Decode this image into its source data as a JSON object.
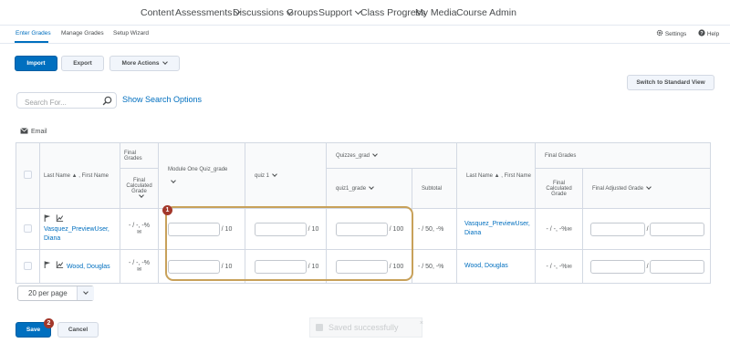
{
  "nav": {
    "items": [
      "Content",
      "Assessments",
      "Discussions",
      "Groups",
      "Support",
      "Class Progress",
      "My Media",
      "Course Admin"
    ]
  },
  "subnav": {
    "tabs": [
      "Enter Grades",
      "Manage Grades",
      "Setup Wizard"
    ],
    "settings": "Settings",
    "help": "Help"
  },
  "toolbar": {
    "import": "Import",
    "export": "Export",
    "more_actions": "More Actions",
    "switch_view": "Switch to Standard View"
  },
  "search": {
    "placeholder": "Search For...",
    "show_options": "Show Search Options"
  },
  "email": "Email",
  "table": {
    "header": {
      "name": "Last Name ▲ , First Name",
      "final_grades_top": "Final Grades",
      "final_calculated": "Final Calculated Grade",
      "module_one": "Module One Quiz_grade",
      "quiz1": "quiz 1",
      "quizzes_grad": "Quizzes_grad",
      "quiz1_grade": "quiz1_grade",
      "subtotal": "Subtotal",
      "name2": "Last Name ▲ , First Name",
      "final_grades2": "Final Grades",
      "final_calculated2": "Final Calculated Grade",
      "final_adjusted": "Final Adjusted Grade"
    },
    "rows": [
      {
        "name": "Vasquez_PreviewUser, Diana",
        "final_calc": "- / -, -%",
        "module_one_max": "/ 10",
        "quiz1_max": "/ 10",
        "quiz1_grade_max": "/ 100",
        "subtotal": "- / 50, -%",
        "name2": "Vasquez_PreviewUser, Diana",
        "final_calc2": "- / -, -%",
        "adjusted_sep": "/"
      },
      {
        "name": "Wood, Douglas",
        "final_calc": "- / -, -%",
        "module_one_max": "/ 10",
        "quiz1_max": "/ 10",
        "quiz1_grade_max": "/ 100",
        "subtotal": "- / 50, -%",
        "name2": "Wood, Douglas",
        "final_calc2": "- / -, -%",
        "adjusted_sep": "/"
      }
    ]
  },
  "per_page": "20 per page",
  "footer": {
    "save": "Save",
    "cancel": "Cancel"
  },
  "toast": "Saved successfully",
  "badges": [
    "1",
    "2"
  ],
  "colors": {
    "accent": "#006fbf",
    "highlight": "#c8a15a",
    "badge": "#a3382b"
  }
}
